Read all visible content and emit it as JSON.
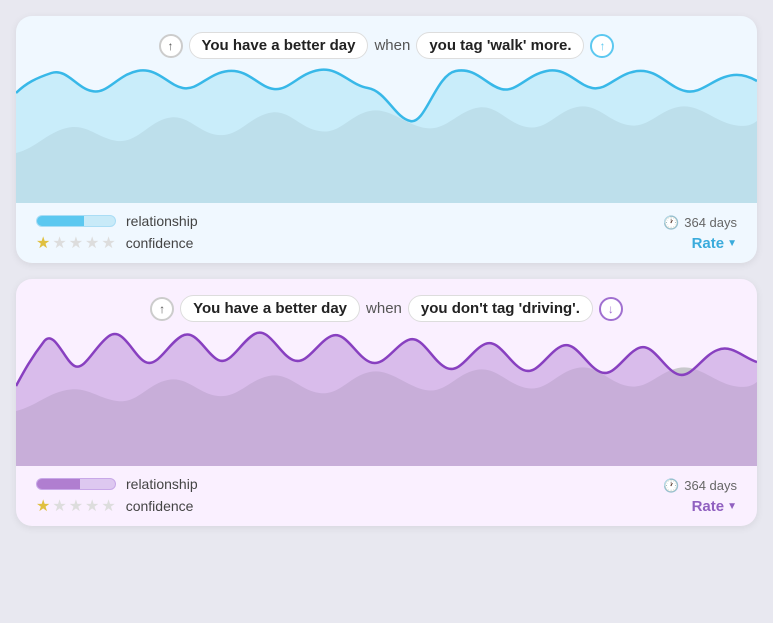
{
  "cards": [
    {
      "id": "card-blue",
      "arrow_left": "↑",
      "main_label": "You have a better day",
      "when_text": "when",
      "tag_label": "you tag 'walk' more.",
      "arrow_right": "↑",
      "arrow_right_color": "blue",
      "chart_color_fill": "#b8e8f8",
      "chart_color_stroke": "#38b8e8",
      "relationship_label": "relationship",
      "confidence_label": "confidence",
      "stars": [
        1,
        0,
        0,
        0,
        0
      ],
      "days_text": "364 days",
      "rate_label": "Rate",
      "rate_color": "blue"
    },
    {
      "id": "card-purple",
      "arrow_left": "↑",
      "main_label": "You have a better day",
      "when_text": "when",
      "tag_label": "you don't tag 'driving'.",
      "arrow_right": "↓",
      "arrow_right_color": "purple",
      "chart_color_fill": "#d0b0e8",
      "chart_color_stroke": "#9050c8",
      "relationship_label": "relationship",
      "confidence_label": "confidence",
      "stars": [
        1,
        0,
        0,
        0,
        0
      ],
      "days_text": "364 days",
      "rate_label": "Rate",
      "rate_color": "purple"
    }
  ]
}
